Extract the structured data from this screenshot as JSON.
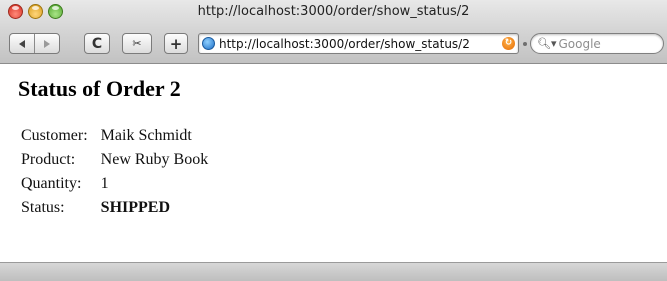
{
  "window": {
    "title": "http://localhost:3000/order/show_status/2"
  },
  "toolbar": {
    "reload_glyph": "C",
    "snip_glyph": "✂",
    "add_glyph": "+",
    "url": "http://localhost:3000/order/show_status/2",
    "search_placeholder": "Google",
    "icons": {
      "back": "back-arrow-icon",
      "forward": "forward-arrow-icon",
      "reload": "reload-icon",
      "snip": "snippet-icon",
      "add": "add-bookmark-icon",
      "site": "globe-icon",
      "feed": "feed-icon",
      "search": "search-icon"
    }
  },
  "page": {
    "heading": "Status of Order 2",
    "rows": [
      {
        "label": "Customer:",
        "value": "Maik Schmidt"
      },
      {
        "label": "Product:",
        "value": "New Ruby Book"
      },
      {
        "label": "Quantity:",
        "value": "1"
      },
      {
        "label": "Status:",
        "value": "SHIPPED"
      }
    ]
  },
  "colors": {
    "close": "#d4281c",
    "minimize": "#d69a16",
    "maximize": "#4ea32a"
  }
}
